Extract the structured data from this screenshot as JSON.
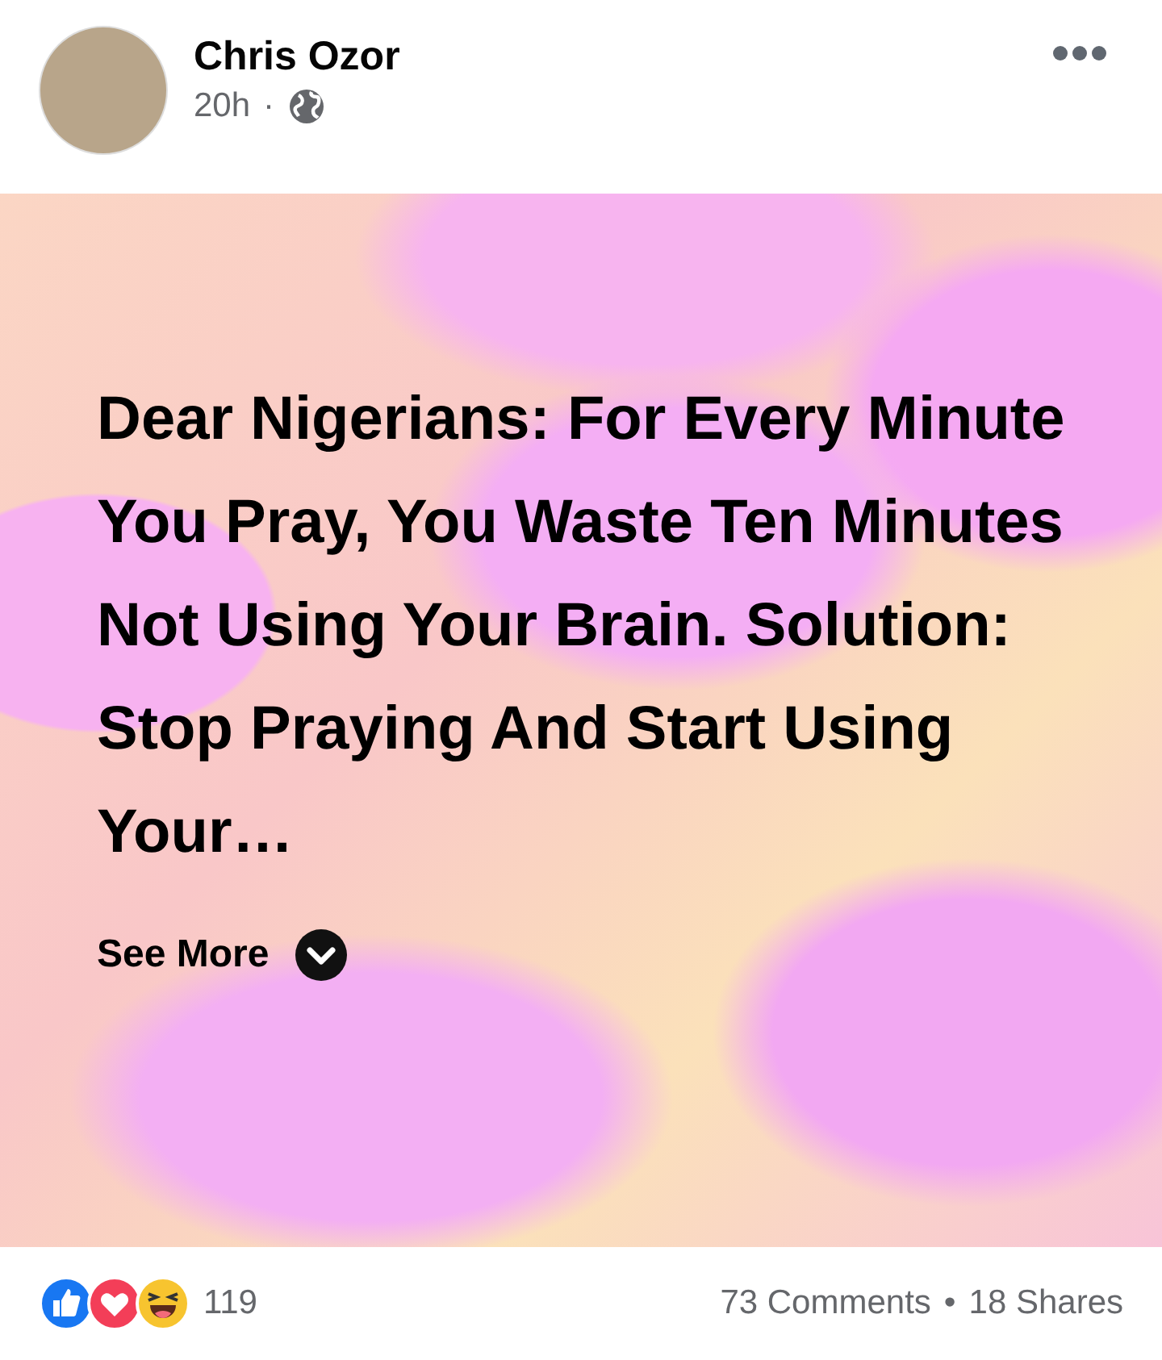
{
  "post": {
    "author": "Chris Ozor",
    "time": "20h",
    "separator": "·",
    "text": "Dear Nigerians: For Every Minute You Pray, You Waste Ten Minutes Not Using Your Brain. Solution: Stop Praying And Start Using Your…",
    "see_more": "See More"
  },
  "reactions": {
    "count": "119"
  },
  "stats": {
    "comments": "73 Comments",
    "separator": "•",
    "shares": "18 Shares"
  }
}
